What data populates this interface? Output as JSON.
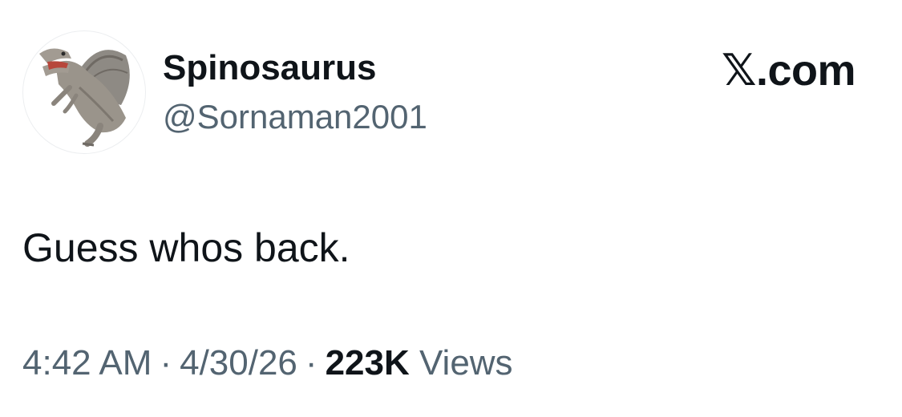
{
  "author": {
    "display_name": "Spinosaurus",
    "handle": "@Sornaman2001",
    "avatar_icon": "spinosaurus-avatar"
  },
  "brand": {
    "label": "𝕏.com"
  },
  "tweet": {
    "text": "Guess whos back."
  },
  "meta": {
    "time": "4:42 AM",
    "separator": "·",
    "date": "4/30/26",
    "views_count": "223K",
    "views_label": "Views"
  },
  "colors": {
    "text_primary": "#0f1419",
    "text_secondary": "#536471",
    "background": "#ffffff"
  }
}
